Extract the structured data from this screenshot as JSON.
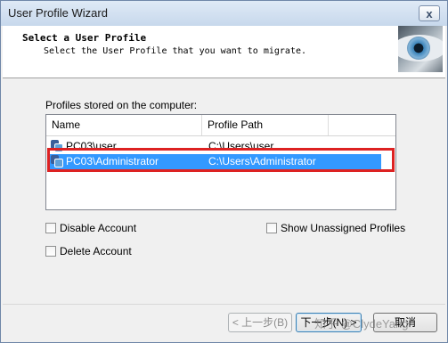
{
  "window": {
    "title": "User Profile Wizard",
    "close_label": "x"
  },
  "header": {
    "title": "Select a User Profile",
    "subtitle": "Select the User Profile that you want to migrate."
  },
  "profiles": {
    "group_label": "Profiles stored on the computer:",
    "columns": [
      "Name",
      "Profile Path"
    ],
    "rows": [
      {
        "name": "PC03\\user",
        "path": "C:\\Users\\user",
        "selected": false
      },
      {
        "name": "PC03\\Administrator",
        "path": "C:\\Users\\Administrator",
        "selected": true
      }
    ]
  },
  "options": {
    "disable_account": {
      "label": "Disable Account",
      "checked": false
    },
    "delete_account": {
      "label": "Delete Account",
      "checked": false
    },
    "show_unassigned": {
      "label": "Show Unassigned Profiles",
      "checked": false
    }
  },
  "buttons": {
    "back": "< 上一步(B)",
    "next": "下一步(N) >",
    "cancel": "取消"
  },
  "watermark": "知乎 @ClydeYang",
  "colors": {
    "selection": "#3399ff",
    "highlight_border": "#dd2222"
  }
}
